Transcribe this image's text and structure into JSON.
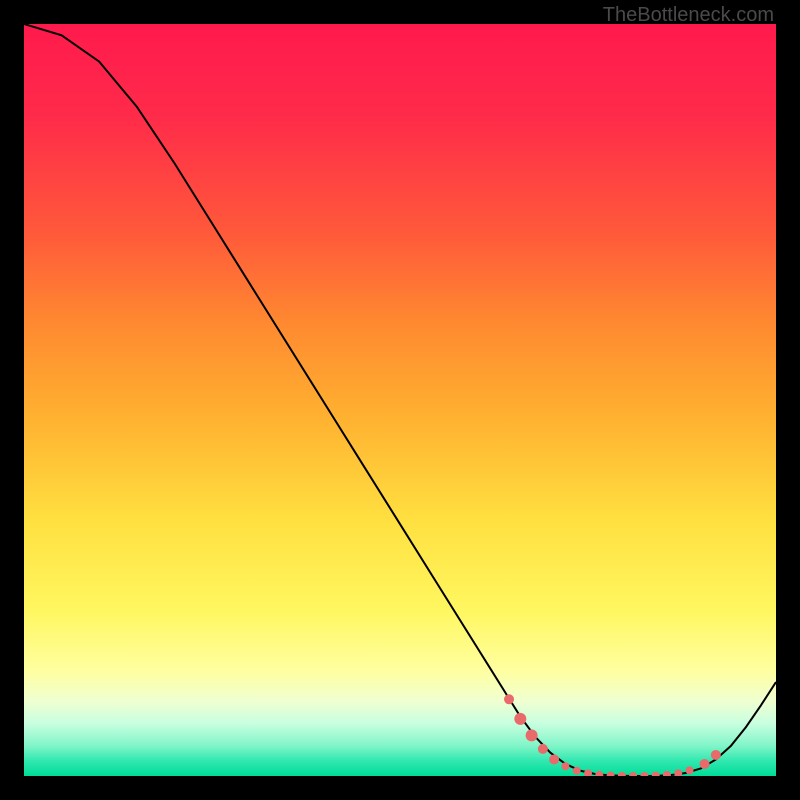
{
  "watermark": "TheBottleneck.com",
  "chart_data": {
    "type": "line",
    "title": "",
    "xlabel": "",
    "ylabel": "",
    "xlim": [
      0,
      100
    ],
    "ylim": [
      0,
      100
    ],
    "series": [
      {
        "name": "curve",
        "x": [
          0,
          5,
          10,
          15,
          20,
          25,
          30,
          35,
          40,
          45,
          50,
          55,
          60,
          62,
          64,
          66,
          68,
          70,
          72,
          74,
          76,
          78,
          80,
          82,
          84,
          86,
          88,
          90,
          92,
          94,
          96,
          98,
          100
        ],
        "y": [
          100,
          98.5,
          95,
          89,
          81.5,
          73.5,
          65.5,
          57.5,
          49.5,
          41.5,
          33.5,
          25.5,
          17.5,
          14.3,
          11.1,
          7.9,
          5.2,
          3.1,
          1.6,
          0.7,
          0.25,
          0.08,
          0.02,
          0.0,
          0.02,
          0.12,
          0.4,
          1.0,
          2.2,
          4.0,
          6.5,
          9.4,
          12.5
        ]
      }
    ],
    "markers": [
      {
        "x": 64.5,
        "y": 10.2,
        "r": 5
      },
      {
        "x": 66.0,
        "y": 7.6,
        "r": 6
      },
      {
        "x": 67.5,
        "y": 5.4,
        "r": 6
      },
      {
        "x": 69.0,
        "y": 3.6,
        "r": 5
      },
      {
        "x": 70.5,
        "y": 2.2,
        "r": 5
      },
      {
        "x": 72.0,
        "y": 1.3,
        "r": 4
      },
      {
        "x": 73.5,
        "y": 0.7,
        "r": 4
      },
      {
        "x": 75.0,
        "y": 0.35,
        "r": 4
      },
      {
        "x": 76.5,
        "y": 0.15,
        "r": 4
      },
      {
        "x": 78.0,
        "y": 0.06,
        "r": 4
      },
      {
        "x": 79.5,
        "y": 0.02,
        "r": 4
      },
      {
        "x": 81.0,
        "y": 0.0,
        "r": 4
      },
      {
        "x": 82.5,
        "y": 0.0,
        "r": 4
      },
      {
        "x": 84.0,
        "y": 0.05,
        "r": 4
      },
      {
        "x": 85.5,
        "y": 0.15,
        "r": 4
      },
      {
        "x": 87.0,
        "y": 0.35,
        "r": 4
      },
      {
        "x": 88.5,
        "y": 0.75,
        "r": 4
      },
      {
        "x": 90.5,
        "y": 1.6,
        "r": 5
      },
      {
        "x": 92.0,
        "y": 2.8,
        "r": 5
      }
    ],
    "marker_color": "#e86a6a",
    "curve_color": "#000000"
  }
}
